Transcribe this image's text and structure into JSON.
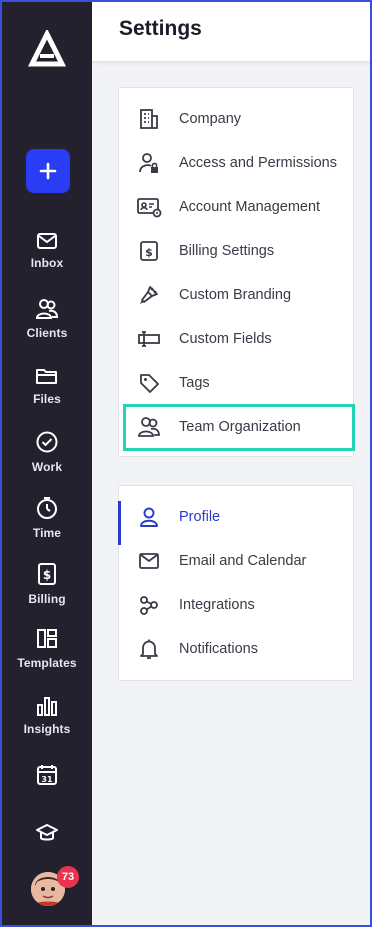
{
  "header": {
    "title": "Settings"
  },
  "sidebar": {
    "add_label": "+",
    "items": [
      {
        "label": "Inbox",
        "icon": "mail-icon"
      },
      {
        "label": "Clients",
        "icon": "clients-icon"
      },
      {
        "label": "Files",
        "icon": "folder-icon"
      },
      {
        "label": "Work",
        "icon": "check-circle-icon"
      },
      {
        "label": "Time",
        "icon": "timer-icon"
      },
      {
        "label": "Billing",
        "icon": "billing-icon"
      },
      {
        "label": "Templates",
        "icon": "templates-icon"
      },
      {
        "label": "Insights",
        "icon": "bar-chart-icon"
      },
      {
        "label": "",
        "icon": "calendar-icon"
      },
      {
        "label": "",
        "icon": "graduation-cap-icon"
      }
    ],
    "calendar_day": "31",
    "notification_count": "73"
  },
  "firm_settings": {
    "items": [
      {
        "label": "Company",
        "icon": "building-icon"
      },
      {
        "label": "Access and Permissions",
        "icon": "user-lock-icon"
      },
      {
        "label": "Account Management",
        "icon": "id-card-gear-icon"
      },
      {
        "label": "Billing Settings",
        "icon": "dollar-doc-icon"
      },
      {
        "label": "Custom Branding",
        "icon": "brush-icon"
      },
      {
        "label": "Custom Fields",
        "icon": "text-field-icon"
      },
      {
        "label": "Tags",
        "icon": "tag-icon"
      },
      {
        "label": "Team Organization",
        "icon": "team-icon"
      }
    ]
  },
  "personal_settings": {
    "items": [
      {
        "label": "Profile",
        "icon": "person-icon",
        "active": true
      },
      {
        "label": "Email and Calendar",
        "icon": "envelope-icon"
      },
      {
        "label": "Integrations",
        "icon": "integrations-icon"
      },
      {
        "label": "Notifications",
        "icon": "bell-icon"
      }
    ]
  },
  "colors": {
    "sidebar": "#23212e",
    "accent": "#2b3cf5",
    "active_text": "#2b3cc9",
    "highlight": "#23d3b5",
    "badge": "#e8344f"
  }
}
